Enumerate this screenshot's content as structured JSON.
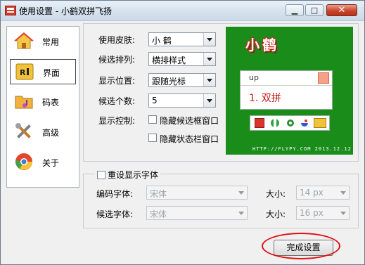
{
  "window": {
    "title": "使用设置 - 小鹤双拼飞扬"
  },
  "titlebar_buttons": {
    "minimize": "▁",
    "maximize": "□",
    "close": "✕"
  },
  "sidebar": {
    "items": [
      {
        "label": "常用",
        "icon": "house-icon"
      },
      {
        "label": "界面",
        "icon": "interface-icon",
        "selected": true
      },
      {
        "label": "码表",
        "icon": "folder-music-icon"
      },
      {
        "label": "高级",
        "icon": "tools-icon"
      },
      {
        "label": "关于",
        "icon": "chrome-ball-icon"
      }
    ]
  },
  "interface": {
    "skin_label": "使用皮肤:",
    "skin_value": "小 鹤",
    "order_label": "候选排列:",
    "order_value": "横排样式",
    "position_label": "显示位置:",
    "position_value": "跟随光标",
    "count_label": "候选个数:",
    "count_value": "5",
    "control_label": "显示控制:",
    "hide_candidate_frame": "隐藏候选框窗口",
    "hide_status_bar": "隐藏状态栏窗口"
  },
  "preview": {
    "brand": "小鹤",
    "input_text": "up",
    "candidate": "1. 双拼",
    "url": "HTTP://FLYPY.COM 2013.12.12",
    "colors": {
      "background": "#1a8c1a",
      "candidate": "#c31b12"
    }
  },
  "font_settings": {
    "reset_label": "重设显示字体",
    "code_font_label": "编码字体:",
    "code_font_value": "宋体",
    "code_size_label": "大小:",
    "code_size_value": "14 px",
    "candidate_font_label": "候选字体:",
    "candidate_font_value": "宋体",
    "candidate_size_label": "大小:",
    "candidate_size_value": "16 px"
  },
  "footer": {
    "done_label": "完成设置"
  }
}
